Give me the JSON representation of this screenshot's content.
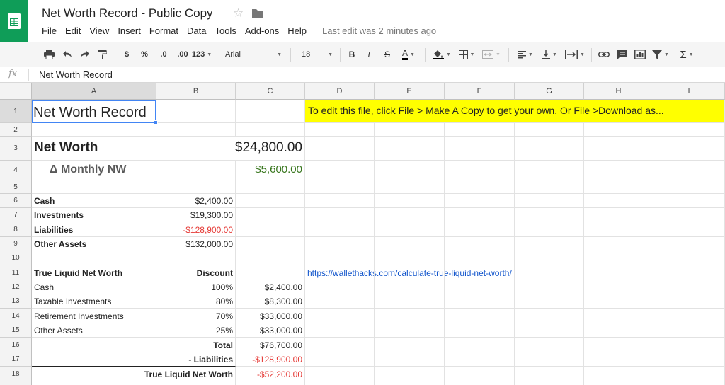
{
  "app": {
    "title": "Net Worth Record - Public Copy",
    "star_icon": "star-outline-icon",
    "folder_icon": "folder-icon",
    "last_edit": "Last edit was 2 minutes ago",
    "accent_color": "#0f9d58"
  },
  "menu": [
    "File",
    "Edit",
    "View",
    "Insert",
    "Format",
    "Data",
    "Tools",
    "Add-ons",
    "Help"
  ],
  "toolbar": {
    "currency": "$",
    "percent": "%",
    "decrease_decimals": ".0",
    "increase_decimals": ".00",
    "more_formats": "123",
    "font": "Arial",
    "font_size": "18",
    "bold": "B",
    "italic": "I",
    "strike": "S",
    "text_color": "A",
    "sum": "Σ"
  },
  "formula_bar": {
    "fx": "fx",
    "value": "Net Worth Record"
  },
  "columns": [
    "A",
    "B",
    "C",
    "D",
    "E",
    "F",
    "G",
    "H",
    "I"
  ],
  "rows": [
    "1",
    "2",
    "3",
    "4",
    "5",
    "6",
    "7",
    "8",
    "9",
    "10",
    "11",
    "12",
    "13",
    "14",
    "15",
    "16",
    "17",
    "18"
  ],
  "cells": {
    "A1": "Net Worth Record",
    "D1": "To edit this file, click File > Make A Copy to get your own. Or File >Download as...",
    "A3": "Net Worth",
    "B3": "$24,800.00",
    "A4": "Δ Monthly NW",
    "C4": "$5,600.00",
    "A6": "Cash",
    "B6": "$2,400.00",
    "A7": "Investments",
    "B7": "$19,300.00",
    "A8": "Liabilities",
    "B8": "-$128,900.00",
    "A9": "Other Assets",
    "B9": "$132,000.00",
    "A11": "True Liquid Net Worth",
    "B11": "Discount",
    "D11": "https://wallethacks.com/calculate-true-liquid-net-worth/",
    "A12": "Cash",
    "B12": "100%",
    "C12": "$2,400.00",
    "A13": "Taxable Investments",
    "B13": "80%",
    "C13": "$8,300.00",
    "A14": "Retirement Investments",
    "B14": "70%",
    "C14": "$33,000.00",
    "A15": "Other Assets",
    "B15": "25%",
    "C15": "$33,000.00",
    "B16": "Total",
    "C16": "$76,700.00",
    "B17": "- Liabilities",
    "C17": "-$128,900.00",
    "B18": "True Liquid Net Worth",
    "C18": "-$52,200.00"
  },
  "colors": {
    "negative": "#e53935",
    "positive": "#38761d",
    "highlight": "#ffff00",
    "link": "#1155cc",
    "selection": "#4285f4"
  }
}
